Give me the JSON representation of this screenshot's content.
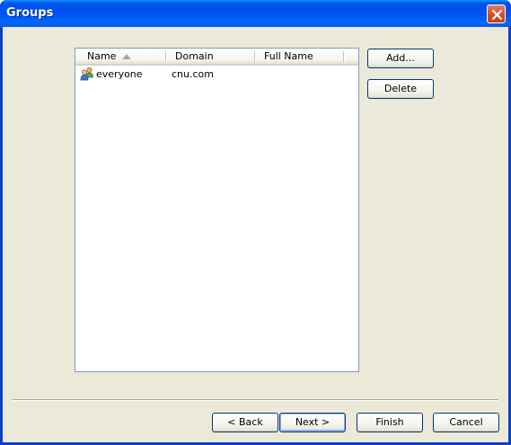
{
  "window": {
    "title": "Groups"
  },
  "list": {
    "columns": [
      "Name",
      "Domain",
      "Full Name"
    ],
    "sort_column": "Name",
    "sort_direction": "ascending",
    "rows": [
      {
        "name": "everyone",
        "domain": "cnu.com",
        "full_name": "",
        "icon": "group-icon"
      }
    ]
  },
  "buttons": {
    "add": "Add...",
    "delete": "Delete",
    "back": "< Back",
    "next": "Next >",
    "finish": "Finish",
    "cancel": "Cancel"
  },
  "colors": {
    "titlebar": "#0053ee",
    "dialog_background": "#ece9d8",
    "close_button": "#d6502c"
  }
}
